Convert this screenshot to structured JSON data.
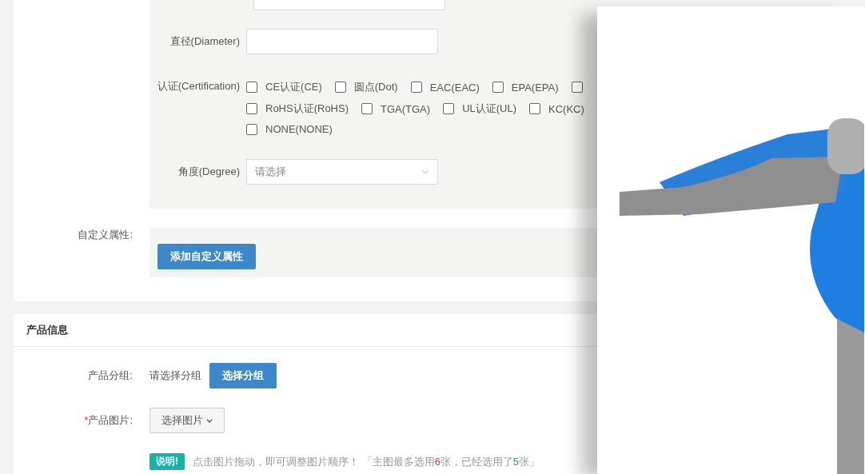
{
  "attributes": {
    "fields": [
      {
        "kind": "cut"
      },
      {
        "kind": "input",
        "label": "直径(Diameter)"
      },
      {
        "kind": "checkboxes",
        "label": "认证(Certification)",
        "rows": [
          [
            {
              "label": "CE认证(CE)",
              "checked": false
            },
            {
              "label": "圆点(Dot)",
              "checked": false
            },
            {
              "label": "EAC(EAC)",
              "checked": false
            },
            {
              "label": "EPA(EPA)",
              "checked": false
            },
            {
              "checked": false
            }
          ],
          [
            {
              "label": "RoHS认证(RoHS)",
              "checked": false
            },
            {
              "label": "TGA(TGA)",
              "checked": false
            },
            {
              "label": "UL认证(UL)",
              "checked": false
            },
            {
              "label": "KC(KC)",
              "checked": false
            }
          ],
          [
            {
              "label": "NONE(NONE)",
              "checked": false
            }
          ]
        ]
      },
      {
        "kind": "select",
        "label": "角度(Degree)",
        "placeholder": "请选择"
      }
    ],
    "custom_label": "自定义属性:",
    "custom_button": "添加自定义属性"
  },
  "product_info": {
    "title": "产品信息",
    "group": {
      "label": "产品分组:",
      "value": "请选择分组",
      "button": "选择分组"
    },
    "images": {
      "required_mark": "*",
      "label": "产品图片:",
      "button": "选择图片"
    },
    "note": {
      "badge": "说明!",
      "text_before": "点击图片拖动，即可调整图片顺序！ 「主图最多选用",
      "max": "6",
      "text_middle": "张，已经选用了",
      "count": "5",
      "text_after": "张」"
    }
  }
}
